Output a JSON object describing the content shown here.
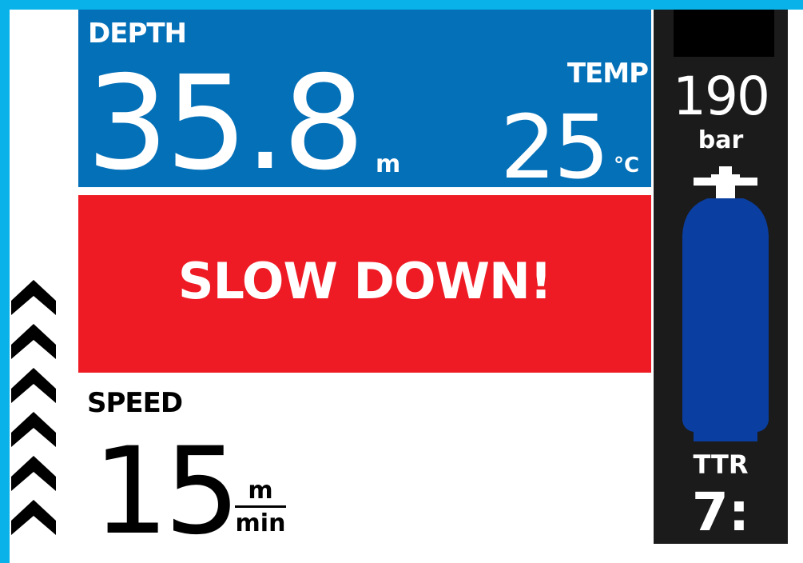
{
  "depth": {
    "label": "DEPTH",
    "value": "35.8",
    "unit": "m"
  },
  "temperature": {
    "label": "TEMP",
    "value": "25",
    "unit": "°C"
  },
  "warning": {
    "text": "SLOW DOWN!"
  },
  "speed": {
    "label": "SPEED",
    "value": "15",
    "unit_top": "m",
    "unit_bottom": "min"
  },
  "tank": {
    "pressure": "190",
    "unit": "bar"
  },
  "ttr": {
    "label": "TTR",
    "value": "7:"
  },
  "colors": {
    "frame": "#0ab2ea",
    "depth_panel": "#0470b8",
    "warning": "#ee1b24",
    "tank": "#0a3ea0",
    "side_panel": "#1b1b1b"
  },
  "icons": {
    "ascent_arrows": "chevron-up-icon",
    "tank": "cylinder-icon"
  }
}
